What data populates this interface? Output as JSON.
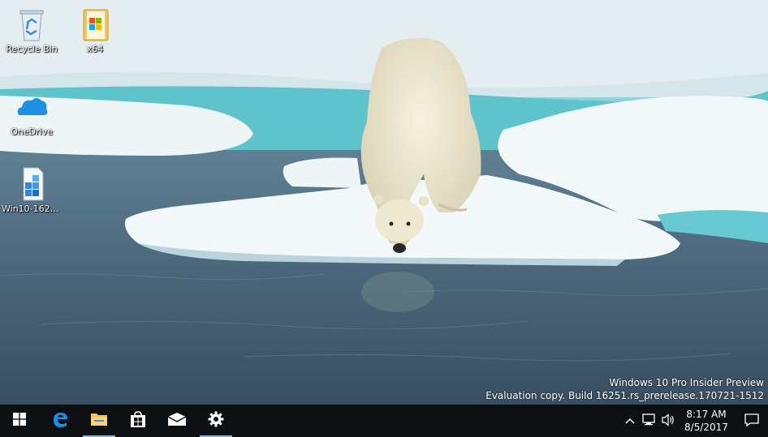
{
  "desktop": {
    "icons": [
      {
        "label": "Recycle Bin",
        "icon": "recycle-bin-icon"
      },
      {
        "label": "x64",
        "icon": "folder-icon"
      },
      {
        "label": "OneDrive",
        "icon": "onedrive-icon"
      },
      {
        "label": "Win10-1625...",
        "icon": "registry-file-icon"
      }
    ]
  },
  "watermark": {
    "line1": "Windows 10 Pro Insider Preview",
    "line2": "Evaluation copy. Build 16251.rs_prerelease.170721-1512"
  },
  "taskbar": {
    "pinned": [
      {
        "name": "start-button",
        "icon": "windows-logo-icon"
      },
      {
        "name": "edge-button",
        "icon": "edge-icon"
      },
      {
        "name": "file-explorer-button",
        "icon": "folder-icon"
      },
      {
        "name": "store-button",
        "icon": "store-icon"
      },
      {
        "name": "mail-button",
        "icon": "mail-icon"
      },
      {
        "name": "settings-button",
        "icon": "gear-icon"
      }
    ],
    "clock": {
      "time": "8:17 AM",
      "date": "8/5/2017"
    }
  },
  "colors": {
    "taskbar": "#0d1013",
    "accent": "#76b9ed"
  }
}
